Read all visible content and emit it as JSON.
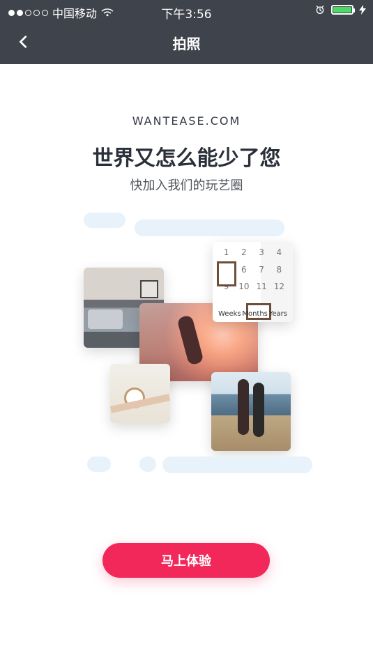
{
  "status_bar": {
    "carrier": "中国移动",
    "time": "下午3:56",
    "signal": {
      "filled": 2,
      "empty": 3
    },
    "icons": {
      "wifi": "wifi-icon",
      "alarm": "alarm-icon",
      "battery": "battery-icon",
      "charging": "bolt-icon"
    },
    "colors": {
      "battery_fill": "#4cd964"
    }
  },
  "nav": {
    "title": "拍照",
    "back_icon": "chevron-left-icon"
  },
  "hero": {
    "brand": "WANTEASE.COM",
    "headline": "世界又怎么能少了您",
    "subline": "快加入我们的玩艺圈"
  },
  "photos": {
    "baby_grid_numbers": [
      "1",
      "2",
      "3",
      "4",
      "5",
      "6",
      "7",
      "8",
      "9",
      "10",
      "11",
      "12"
    ],
    "labels": [
      "Weeks",
      "Months",
      "Years"
    ]
  },
  "cta": {
    "label": "马上体验"
  },
  "colors": {
    "topbar_bg": "#3f434c",
    "primary": "#f2285a",
    "text_dark": "#2a2f39",
    "text_subtle": "#51555e",
    "pill_bg": "#e8f2fb"
  }
}
